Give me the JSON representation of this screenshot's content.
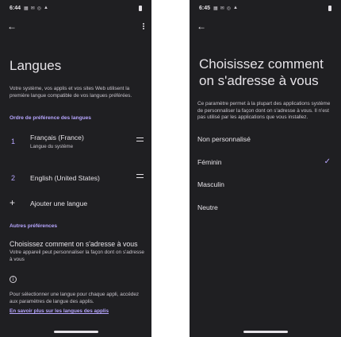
{
  "left_screen": {
    "status": {
      "time": "6:44",
      "icons": [
        "▦",
        "✉",
        "◎",
        "▲"
      ]
    },
    "back_icon": "←",
    "title": "Langues",
    "intro": "Votre système, vos applis et vos sites Web utilisent la première langue compatible de vos langues préférées.",
    "section_order": "Ordre de préférence des langues",
    "languages": [
      {
        "number": "1",
        "name": "Français (France)",
        "subtitle": "Langue du système"
      },
      {
        "number": "2",
        "name": "English (United States)",
        "subtitle": ""
      }
    ],
    "add_icon": "+",
    "add_language": "Ajouter une langue",
    "section_other": "Autres préférences",
    "address_title": "Choisissez comment on s'adresse à vous",
    "address_desc": "Votre appareil peut personnaliser la façon dont on s'adresse à vous",
    "info_icon": "i",
    "info_text": "Pour sélectionner une langue pour chaque appli, accédez aux paramètres de langue des applis.",
    "link_text": "En savoir plus sur les langues des applis"
  },
  "right_screen": {
    "status": {
      "time": "6:45",
      "icons": [
        "▦",
        "✉",
        "◎",
        "▲"
      ]
    },
    "back_icon": "←",
    "title": "Choisissez comment on s'adresse à vous",
    "desc": "Ce paramètre permet à la plupart des applications système de personnaliser la façon dont on s'adresse à vous. Il n'est pas utilisé par les applications que vous installez.",
    "options": [
      {
        "label": "Non personnalisé",
        "selected": false
      },
      {
        "label": "Féminin",
        "selected": true
      },
      {
        "label": "Masculin",
        "selected": false
      },
      {
        "label": "Neutre",
        "selected": false
      }
    ],
    "check_icon": "✓"
  }
}
